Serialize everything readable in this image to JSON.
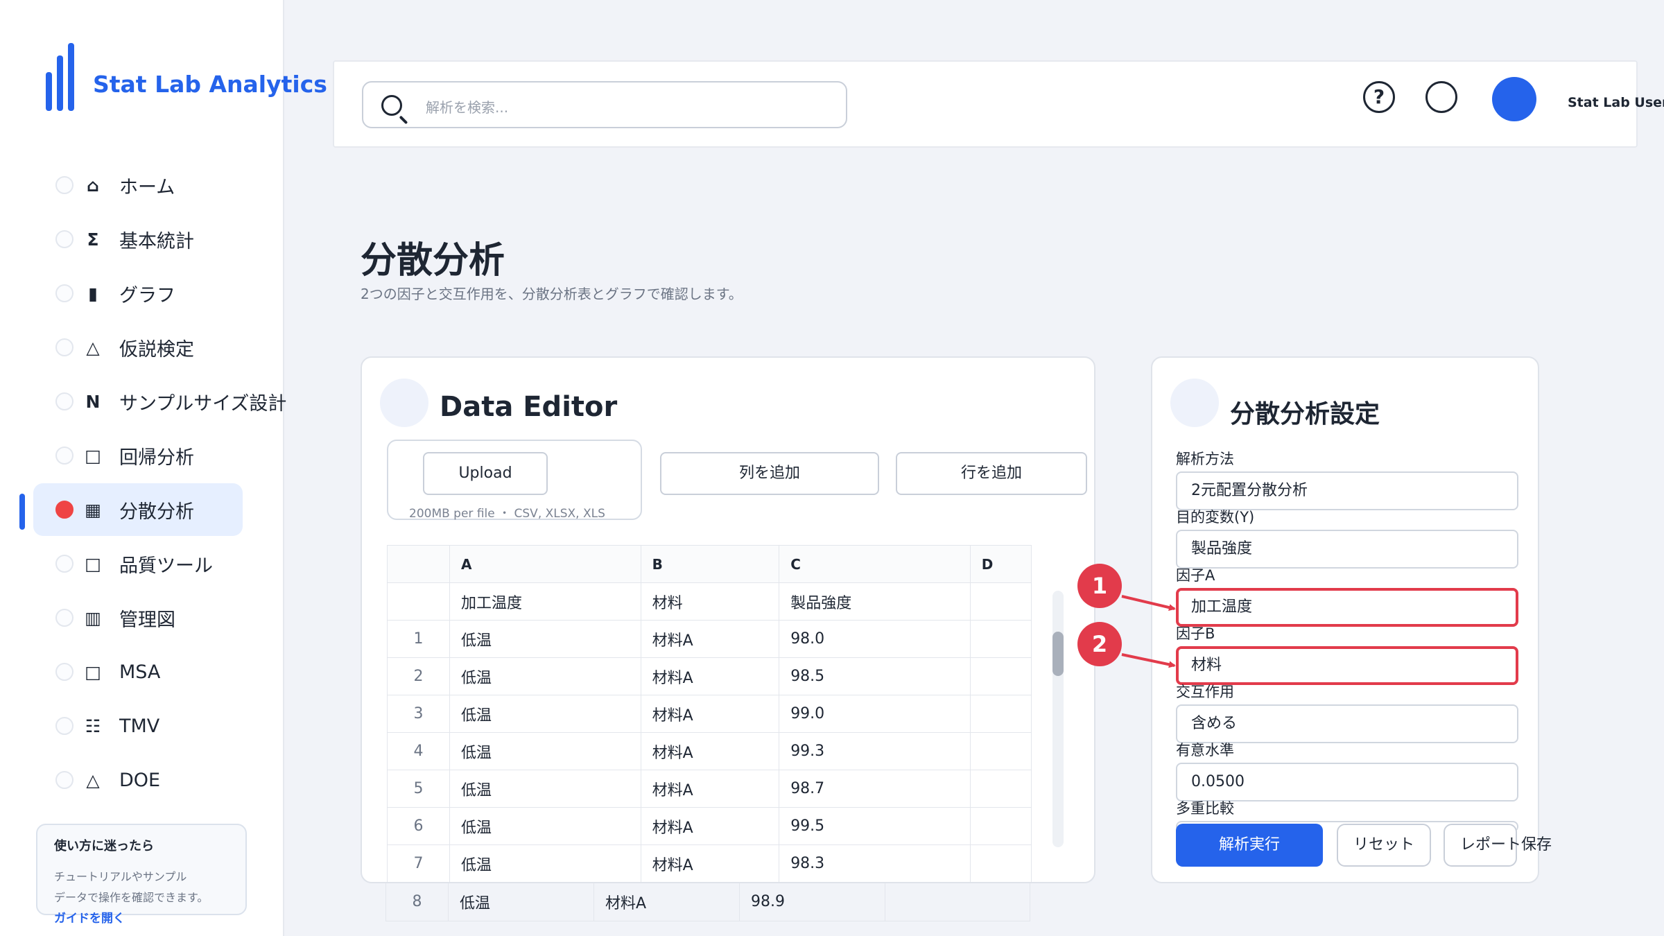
{
  "app": {
    "title": "Stat Lab Analytics",
    "brand_color": "#2563eb"
  },
  "sidebar": {
    "items": [
      {
        "label": "ホーム",
        "glyph": "⌂",
        "icon": "home-icon"
      },
      {
        "label": "基本統計",
        "glyph": "Σ",
        "icon": "sigma-icon"
      },
      {
        "label": "グラフ",
        "glyph": "▮",
        "icon": "bar-chart-icon"
      },
      {
        "label": "仮説検定",
        "glyph": "△",
        "icon": "triangle-icon"
      },
      {
        "label": "サンプルサイズ設計",
        "glyph": "N",
        "icon": "n-icon"
      },
      {
        "label": "回帰分析",
        "glyph": "□",
        "icon": "square-icon"
      },
      {
        "label": "分散分析",
        "glyph": "▦",
        "icon": "grid-icon",
        "active": true
      },
      {
        "label": "品質ツール",
        "glyph": "□",
        "icon": "square-icon"
      },
      {
        "label": "管理図",
        "glyph": "▥",
        "icon": "columns-icon"
      },
      {
        "label": "MSA",
        "glyph": "□",
        "icon": "square-icon"
      },
      {
        "label": "TMV",
        "glyph": "☷",
        "icon": "list-icon"
      },
      {
        "label": "DOE",
        "glyph": "△",
        "icon": "triangle-icon"
      }
    ],
    "help": {
      "title": "使い方に迷ったら",
      "body": "チュートリアルやサンプル\nデータで操作を確認できます。",
      "link": "ガイドを開く"
    }
  },
  "header": {
    "search_placeholder": "解析を検索...",
    "help_glyph": "?",
    "user_name": "Stat Lab User"
  },
  "page": {
    "title": "分散分析",
    "subtitle": "2つの因子と交互作用を、分散分析表とグラフで確認します。"
  },
  "editor": {
    "title": "Data Editor",
    "upload_label": "Upload",
    "upload_note": "200MB per file ・ CSV, XLSX, XLS",
    "add_column_label": "列を追加",
    "add_row_label": "行を追加",
    "columns": [
      "A",
      "B",
      "C",
      "D"
    ],
    "header_row": [
      "加工温度",
      "材料",
      "製品強度",
      ""
    ],
    "rows": [
      {
        "n": "1",
        "a": "低温",
        "b": "材料A",
        "c": "98.0",
        "d": ""
      },
      {
        "n": "2",
        "a": "低温",
        "b": "材料A",
        "c": "98.5",
        "d": ""
      },
      {
        "n": "3",
        "a": "低温",
        "b": "材料A",
        "c": "99.0",
        "d": ""
      },
      {
        "n": "4",
        "a": "低温",
        "b": "材料A",
        "c": "99.3",
        "d": ""
      },
      {
        "n": "5",
        "a": "低温",
        "b": "材料A",
        "c": "98.7",
        "d": ""
      },
      {
        "n": "6",
        "a": "低温",
        "b": "材料A",
        "c": "99.5",
        "d": ""
      },
      {
        "n": "7",
        "a": "低温",
        "b": "材料A",
        "c": "98.3",
        "d": ""
      },
      {
        "n": "8",
        "a": "低温",
        "b": "材料A",
        "c": "98.9",
        "d": ""
      }
    ]
  },
  "settings": {
    "title": "分散分析設定",
    "fields": [
      {
        "label": "解析方法",
        "value": "2元配置分散分析"
      },
      {
        "label": "目的変数(Y)",
        "value": "製品強度"
      },
      {
        "label": "因子A",
        "value": "加工温度",
        "highlight": true
      },
      {
        "label": "因子B",
        "value": "材料",
        "highlight": true
      },
      {
        "label": "交互作用",
        "value": "含める"
      },
      {
        "label": "有意水準",
        "value": "0.0500"
      },
      {
        "label": "多重比較",
        "value": ""
      }
    ],
    "run_label": "解析実行",
    "reset_label": "リセット",
    "save_label": "レポート保存"
  },
  "annotations": {
    "marker_1": "1",
    "marker_2": "2",
    "color": "#e23b4b"
  }
}
